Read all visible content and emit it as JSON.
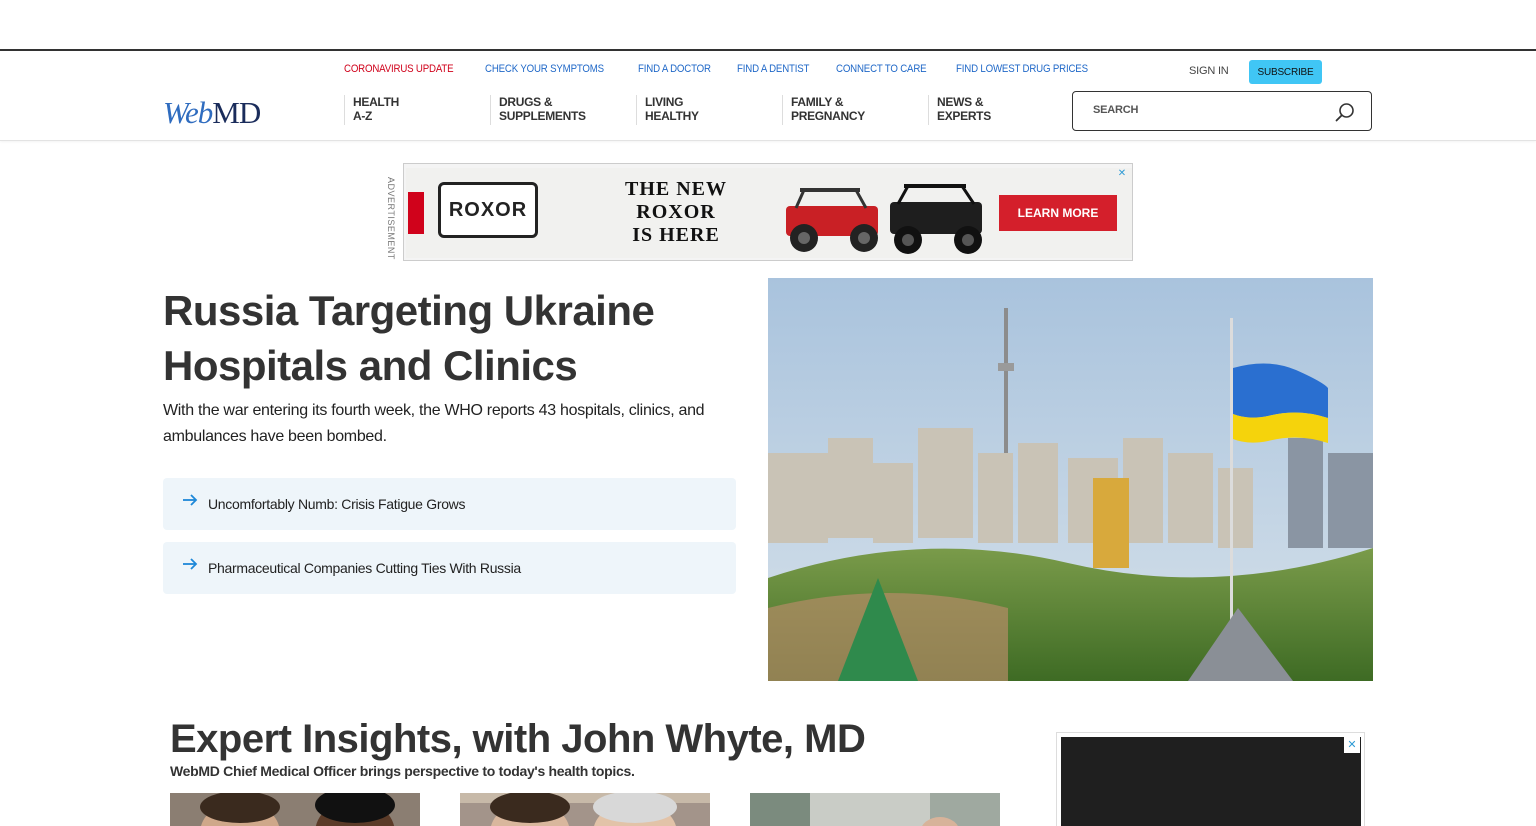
{
  "util_links": [
    {
      "label": "CORONAVIRUS UPDATE",
      "highlight": true
    },
    {
      "label": "CHECK YOUR SYMPTOMS",
      "highlight": false
    },
    {
      "label": "FIND A DOCTOR",
      "highlight": false
    },
    {
      "label": "FIND A DENTIST",
      "highlight": false
    },
    {
      "label": "CONNECT TO CARE",
      "highlight": false
    },
    {
      "label": "FIND LOWEST DRUG PRICES",
      "highlight": false
    }
  ],
  "account": {
    "signin": "SIGN IN",
    "subscribe": "SUBSCRIBE"
  },
  "logo": {
    "web": "Web",
    "md": "MD"
  },
  "nav": [
    {
      "line1": "HEALTH",
      "line2": "A-Z"
    },
    {
      "line1": "DRUGS &",
      "line2": "SUPPLEMENTS"
    },
    {
      "line1": "LIVING",
      "line2": "HEALTHY"
    },
    {
      "line1": "FAMILY &",
      "line2": "PREGNANCY"
    },
    {
      "line1": "NEWS &",
      "line2": "EXPERTS"
    }
  ],
  "search": {
    "placeholder": "SEARCH"
  },
  "ad": {
    "label": "ADVERTISEMENT",
    "brand": "ROXOR",
    "slogan_line1": "THE NEW",
    "slogan_line2": "ROXOR",
    "slogan_line3": "IS HERE",
    "cta": "LEARN MORE"
  },
  "hero": {
    "title": "Russia Targeting Ukraine Hospitals and Clinics",
    "subtitle": "With the war entering its fourth week, the WHO reports 43 hospitals, clinics, and ambulances have been bombed.",
    "related": [
      "Uncomfortably Numb: Crisis Fatigue Grows",
      "Pharmaceutical Companies Cutting Ties With Russia"
    ]
  },
  "expert": {
    "title": "Expert Insights, with John Whyte, MD",
    "subtitle": "WebMD Chief Medical Officer brings perspective to today's health topics."
  },
  "colors": {
    "accent": "#2169c8",
    "alert": "#d0021b",
    "subscribe": "#40c6f5"
  }
}
